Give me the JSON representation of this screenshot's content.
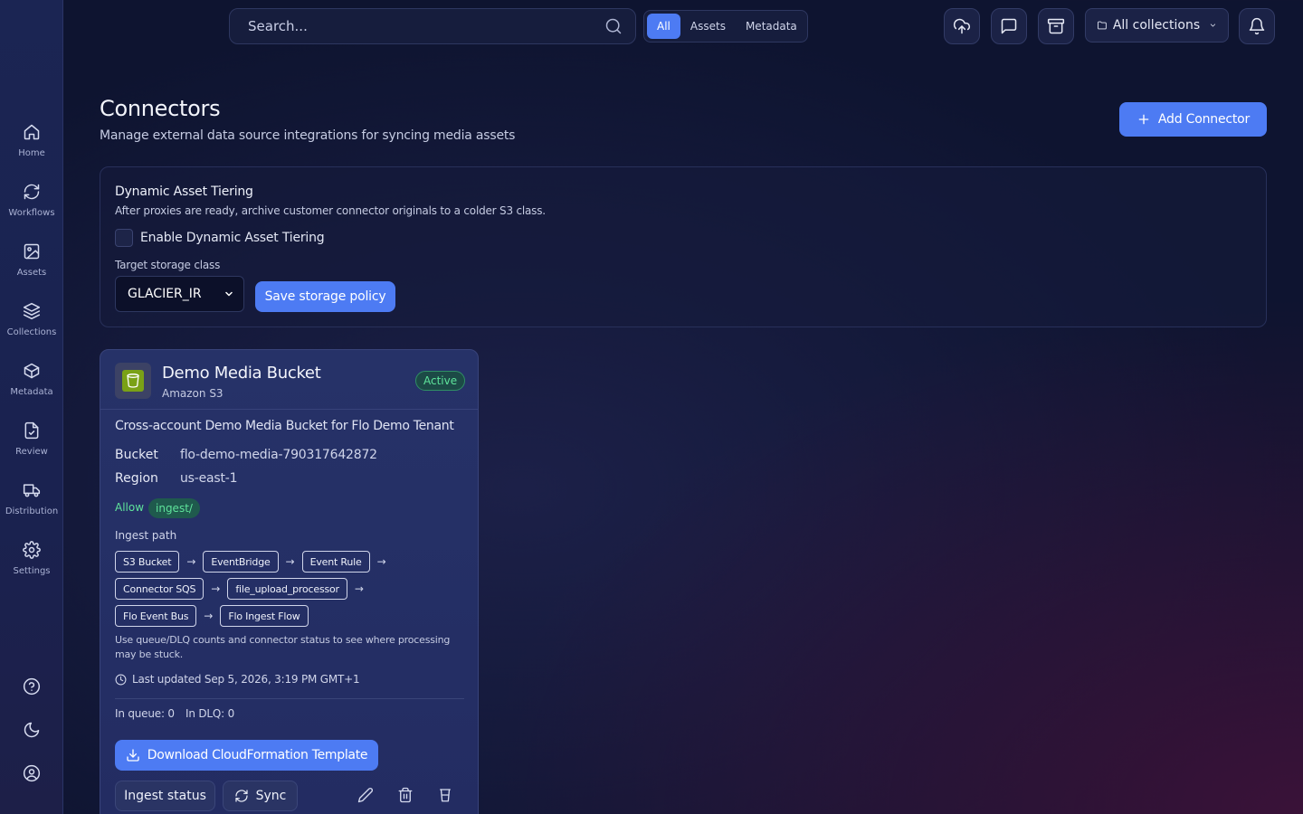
{
  "sidebar": {
    "items": [
      {
        "label": "Home",
        "icon": "home-icon"
      },
      {
        "label": "Workflows",
        "icon": "refresh-icon"
      },
      {
        "label": "Assets",
        "icon": "image-icon"
      },
      {
        "label": "Collections",
        "icon": "layers-icon"
      },
      {
        "label": "Metadata",
        "icon": "box-icon"
      },
      {
        "label": "Review",
        "icon": "file-check-icon"
      },
      {
        "label": "Distribution",
        "icon": "truck-icon"
      },
      {
        "label": "Settings",
        "icon": "gear-icon"
      }
    ],
    "bottom": [
      "help-icon",
      "moon-icon",
      "user-circle-icon"
    ]
  },
  "topbar": {
    "search_placeholder": "Search...",
    "filters": [
      "All",
      "Assets",
      "Metadata"
    ],
    "active_filter": "All",
    "collections_label": "All collections"
  },
  "header": {
    "title": "Connectors",
    "subtitle": "Manage external data source integrations for syncing media assets",
    "add_button": "Add Connector"
  },
  "tiering": {
    "title": "Dynamic Asset Tiering",
    "description": "After proxies are ready, archive customer connector originals to a colder S3 class.",
    "enable_label": "Enable Dynamic Asset Tiering",
    "enabled": false,
    "select_label": "Target storage class",
    "storage_class": "GLACIER_IR",
    "save_button": "Save storage policy"
  },
  "connector": {
    "name": "Demo Media Bucket",
    "type": "Amazon S3",
    "status": "Active",
    "description": "Cross-account Demo Media Bucket for Flo Demo Tenant",
    "bucket_label": "Bucket",
    "bucket": "flo-demo-media-790317642872",
    "region_label": "Region",
    "region": "us-east-1",
    "allow_label": "Allow",
    "allow_prefix": "ingest/",
    "ingest_label": "Ingest path",
    "flow": [
      [
        "S3 Bucket",
        "EventBridge",
        "Event Rule"
      ],
      [
        "Connector SQS",
        "file_upload_processor"
      ],
      [
        "Flo Event Bus",
        "Flo Ingest Flow"
      ]
    ],
    "hint": "Use queue/DLQ counts and connector status to see where processing may be stuck.",
    "last_updated": "Last updated Sep 5, 2026, 3:19 PM GMT+1",
    "in_queue": "In queue: 0",
    "in_dlq": "In DLQ: 0",
    "download_button": "Download CloudFormation Template",
    "ingest_status_button": "Ingest status",
    "sync_button": "Sync"
  },
  "colors": {
    "accent": "#4d7bf3",
    "success": "#5ee39b"
  }
}
